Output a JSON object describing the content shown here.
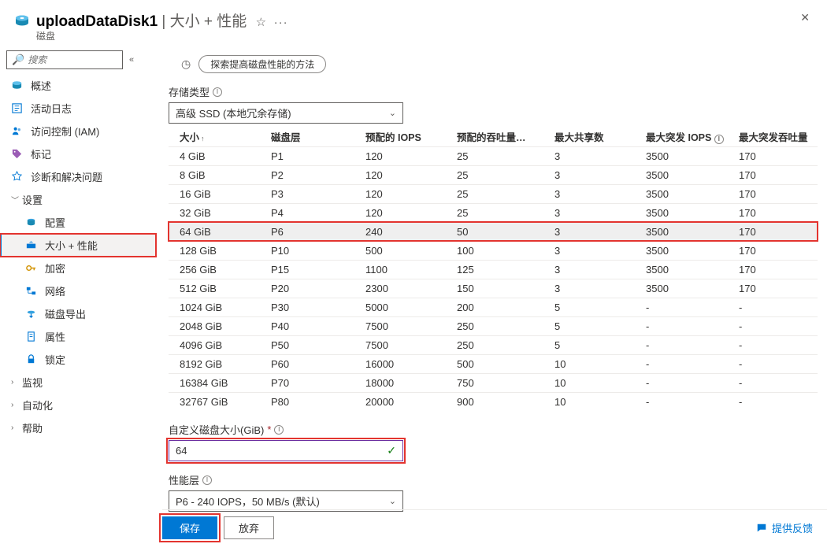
{
  "header": {
    "resource": "uploadDataDisk1",
    "separator": " | ",
    "subtitle_page": "大小 + 性能",
    "sub": "磁盘"
  },
  "sidebar": {
    "search_placeholder": "搜索",
    "items": [
      {
        "label": "概述",
        "icon": "disk",
        "type": "item"
      },
      {
        "label": "活动日志",
        "icon": "log",
        "type": "item"
      },
      {
        "label": "访问控制 (IAM)",
        "icon": "people",
        "type": "item"
      },
      {
        "label": "标记",
        "icon": "tag",
        "type": "item"
      },
      {
        "label": "诊断和解决问题",
        "icon": "diagnose",
        "type": "item"
      },
      {
        "label": "设置",
        "type": "group",
        "expanded": true
      },
      {
        "label": "配置",
        "icon": "config",
        "type": "sub"
      },
      {
        "label": "大小 + 性能",
        "icon": "size",
        "type": "sub",
        "selected": true,
        "highlighted": true
      },
      {
        "label": "加密",
        "icon": "key",
        "type": "sub"
      },
      {
        "label": "网络",
        "icon": "network",
        "type": "sub"
      },
      {
        "label": "磁盘导出",
        "icon": "export",
        "type": "sub"
      },
      {
        "label": "属性",
        "icon": "props",
        "type": "sub"
      },
      {
        "label": "锁定",
        "icon": "lock",
        "type": "sub"
      },
      {
        "label": "监视",
        "type": "group",
        "expanded": false
      },
      {
        "label": "自动化",
        "type": "group",
        "expanded": false
      },
      {
        "label": "帮助",
        "type": "group",
        "expanded": false
      }
    ]
  },
  "main": {
    "help_pill": "探索提高磁盘性能的方法",
    "storage_type_label": "存储类型",
    "storage_type_value": "高级 SSD (本地冗余存储)",
    "table": {
      "headers": [
        "大小",
        "磁盘层",
        "预配的 IOPS",
        "预配的吞吐量…",
        "最大共享数",
        "最大突发 IOPS",
        "最大突发吞吐量"
      ],
      "rows": [
        {
          "c": [
            "4 GiB",
            "P1",
            "120",
            "25",
            "3",
            "3500",
            "170"
          ]
        },
        {
          "c": [
            "8 GiB",
            "P2",
            "120",
            "25",
            "3",
            "3500",
            "170"
          ]
        },
        {
          "c": [
            "16 GiB",
            "P3",
            "120",
            "25",
            "3",
            "3500",
            "170"
          ]
        },
        {
          "c": [
            "32 GiB",
            "P4",
            "120",
            "25",
            "3",
            "3500",
            "170"
          ]
        },
        {
          "c": [
            "64 GiB",
            "P6",
            "240",
            "50",
            "3",
            "3500",
            "170"
          ],
          "selected": true,
          "highlighted": true
        },
        {
          "c": [
            "128 GiB",
            "P10",
            "500",
            "100",
            "3",
            "3500",
            "170"
          ]
        },
        {
          "c": [
            "256 GiB",
            "P15",
            "1100",
            "125",
            "3",
            "3500",
            "170"
          ]
        },
        {
          "c": [
            "512 GiB",
            "P20",
            "2300",
            "150",
            "3",
            "3500",
            "170"
          ]
        },
        {
          "c": [
            "1024 GiB",
            "P30",
            "5000",
            "200",
            "5",
            "-",
            "-"
          ]
        },
        {
          "c": [
            "2048 GiB",
            "P40",
            "7500",
            "250",
            "5",
            "-",
            "-"
          ]
        },
        {
          "c": [
            "4096 GiB",
            "P50",
            "7500",
            "250",
            "5",
            "-",
            "-"
          ]
        },
        {
          "c": [
            "8192 GiB",
            "P60",
            "16000",
            "500",
            "10",
            "-",
            "-"
          ]
        },
        {
          "c": [
            "16384 GiB",
            "P70",
            "18000",
            "750",
            "10",
            "-",
            "-"
          ]
        },
        {
          "c": [
            "32767 GiB",
            "P80",
            "20000",
            "900",
            "10",
            "-",
            "-"
          ]
        }
      ]
    },
    "custom_size_label": "自定义磁盘大小(GiB)",
    "custom_size_value": "64",
    "tier_label": "性能层",
    "tier_value": "P6 - 240 IOPS，50 MB/s (默认)"
  },
  "footer": {
    "save": "保存",
    "discard": "放弃",
    "feedback": "提供反馈"
  }
}
